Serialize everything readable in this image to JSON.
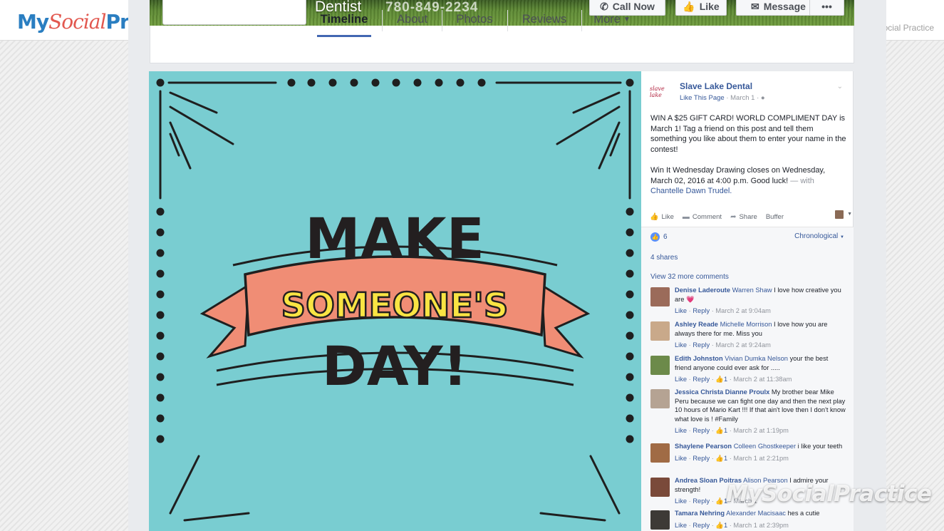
{
  "site": {
    "logo_my": "My",
    "logo_social": "Social",
    "logo_tail": "Pra",
    "right_text": "ocial Practice"
  },
  "cover": {
    "page_name": "Dentist",
    "phone": "780-849-2234",
    "buttons": {
      "call": "Call Now",
      "like": "Like",
      "message": "Message",
      "more": "•••"
    }
  },
  "nav": {
    "tabs": [
      "Timeline",
      "About",
      "Photos",
      "Reviews",
      "More"
    ],
    "active": "Timeline"
  },
  "post": {
    "image_text": {
      "line1": "MAKE",
      "line2": "SOMEONE'S",
      "line3": "DAY!"
    },
    "avatar_text": "slave lake",
    "page": "Slave Lake Dental",
    "like_page": "Like This Page",
    "date": "March 1",
    "paragraph1": "WIN A $25 GIFT CARD! WORLD COMPLIMENT DAY is March 1! Tag a friend on this post and tell them something you like about them to enter your name in the contest!",
    "paragraph2": "Win It Wednesday Drawing closes on Wednesday, March 02, 2016 at 4:00 p.m. Good luck!",
    "with_text": "— with",
    "tagged": "Chantelle Dawn Trudel.",
    "actions": {
      "like": "Like",
      "comment": "Comment",
      "share": "Share",
      "buffer": "Buffer"
    },
    "likes_count": "6",
    "order": "Chronological",
    "shares": "4 shares",
    "view_more": "View 32 more comments"
  },
  "comments": [
    {
      "name": "Denise Laderoute",
      "mention": "Warren Shaw",
      "text": "I love how creative you are 💗",
      "like": "Like",
      "reply": "Reply",
      "count": "",
      "time": "March 2 at 9:04am",
      "av": "#9b6b5a"
    },
    {
      "name": "Ashley Reade",
      "mention": "Michelle Morrison",
      "text": "I love how you are always there for me. Miss you",
      "like": "Like",
      "reply": "Reply",
      "count": "",
      "time": "March 2 at 9:24am",
      "av": "#c9a98a"
    },
    {
      "name": "Edith Johnston",
      "mention": "Vivian Dumka Nelson",
      "text": "your the best friend anyone could ever ask for .....",
      "like": "Like",
      "reply": "Reply",
      "count": "1",
      "time": "March 2 at 11:38am",
      "av": "#6c8a4a"
    },
    {
      "name": "Jessica Christa Dianne Proulx",
      "mention": "",
      "text": "My brother bear Mike Peru because we can fight one day and then the next play 10 hours of Mario Kart !!! If that ain't love then I don't know what love is ! #Family",
      "like": "Like",
      "reply": "Reply",
      "count": "1",
      "time": "March 2 at 1:19pm",
      "av": "#b5a393"
    },
    {
      "name": "Shaylene Pearson",
      "mention": "Colleen Ghostkeeper",
      "text": "i like your teeth",
      "like": "Like",
      "reply": "Reply",
      "count": "1",
      "time": "March 1 at 2:21pm",
      "av": "#a06b45"
    },
    {
      "name": "Andrea Sloan Poitras",
      "mention": "Alison Pearson",
      "text": "I admire your strength!",
      "like": "Like",
      "reply": "Reply",
      "count": "1",
      "time": "March 1",
      "av": "#7a4a3a"
    },
    {
      "name": "Tamara Nehring",
      "mention": "Alexander Macisaac",
      "text": "hes a cutie",
      "like": "Like",
      "reply": "Reply",
      "count": "1",
      "time": "March 1 at 2:39pm",
      "av": "#3d3a36"
    }
  ],
  "watermark": "MySocialPractice"
}
